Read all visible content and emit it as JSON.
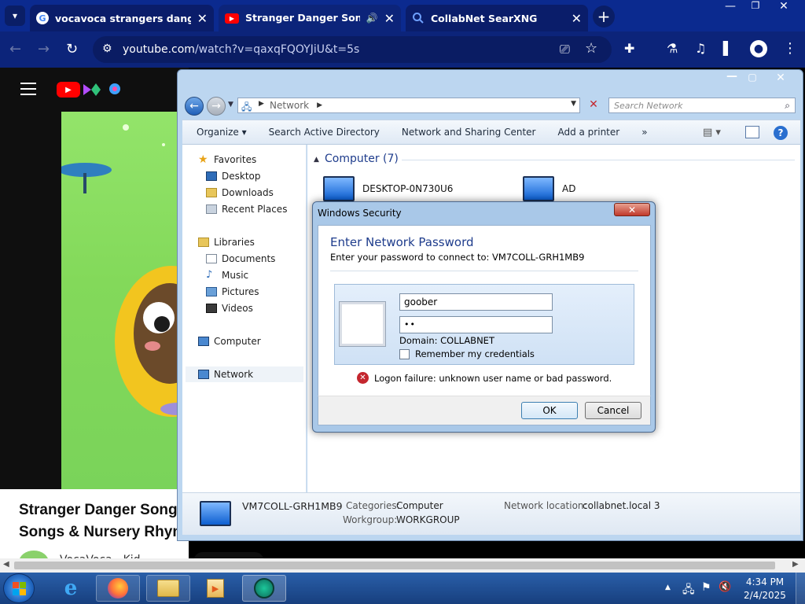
{
  "browser": {
    "tabs": [
      {
        "title": "vocavoca strangers dangers - G",
        "active": false
      },
      {
        "title": "Stranger Danger Song 🎵🎵",
        "active": true
      },
      {
        "title": "CollabNet SearXNG",
        "active": false
      }
    ],
    "url_host": "youtube.com",
    "url_path": "/watch?v=qaxqFQOYJiU&t=5s"
  },
  "youtube": {
    "title_line1": "Stranger Danger Song",
    "title_line2": "Songs & Nursery Rhym",
    "channel": "VocaVoca - Kid"
  },
  "explorer": {
    "address": "Network",
    "search_placeholder": "Search Network",
    "commands": [
      "Organize ▾",
      "Search Active Directory",
      "Network and Sharing Center",
      "Add a printer",
      "»"
    ],
    "nav": {
      "favorites": "Favorites",
      "desktop": "Desktop",
      "downloads": "Downloads",
      "recent": "Recent Places",
      "libraries": "Libraries",
      "documents": "Documents",
      "music": "Music",
      "pictures": "Pictures",
      "videos": "Videos",
      "computer": "Computer",
      "network": "Network"
    },
    "group_header": "Computer (7)",
    "computers": [
      "DESKTOP-0N730U6",
      "AD"
    ],
    "details": {
      "name": "VM7COLL-GRH1MB9",
      "categories_label": "Categories:",
      "categories_value": "Computer",
      "workgroup_label": "Workgroup:",
      "workgroup_value": "WORKGROUP",
      "netloc_label": "Network location:",
      "netloc_value": "collabnet.local 3"
    }
  },
  "dialog": {
    "window_title": "Windows Security",
    "heading": "Enter Network Password",
    "subtitle": "Enter your password to connect to: VM7COLL-GRH1MB9",
    "username_value": "goober",
    "password_value": "••",
    "domain": "Domain: COLLABNET",
    "remember_label": "Remember my credentials",
    "error": "Logon failure: unknown user name or bad password.",
    "ok": "OK",
    "cancel": "Cancel"
  },
  "taskbar": {
    "time": "4:34 PM",
    "date": "2/4/2025"
  },
  "colors": {
    "accent": "#0b2a8f",
    "error": "#c4262e",
    "dialog_heading": "#1e3c8c"
  }
}
